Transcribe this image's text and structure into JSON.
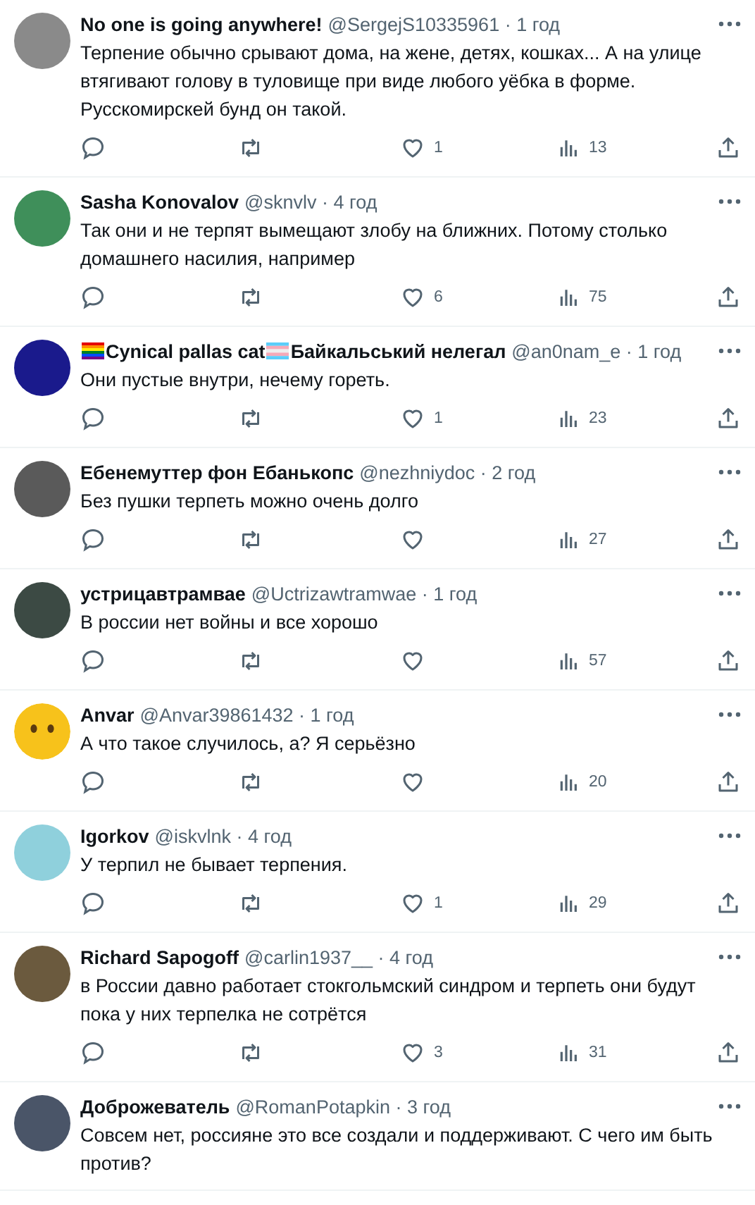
{
  "replies": [
    {
      "avatar": {
        "kind": "photo",
        "color": "#8a8a8a"
      },
      "name_parts": [
        {
          "kind": "text",
          "text": "No one is going anywhere!"
        }
      ],
      "byline": "@SergejS10335961 · 1 год",
      "text": "Терпение обычно срывают дома, на жене, детях, кошках... А на улице втягивают голову в туловище при виде любого уёбка в форме. Русскомирскей бунд он такой.",
      "likes": "1",
      "views": "13"
    },
    {
      "avatar": {
        "kind": "photo",
        "color": "#3f8f5a"
      },
      "name_parts": [
        {
          "kind": "text",
          "text": "Sasha Konovalov"
        }
      ],
      "byline": "@sknvlv · 4 год",
      "text": "Так они и не терпят вымещают злобу на ближних. Потому столько домашнего насилия, например",
      "likes": "6",
      "views": "75"
    },
    {
      "avatar": {
        "kind": "photo",
        "color": "#1a1a8c"
      },
      "name_parts": [
        {
          "kind": "rainbow_flag"
        },
        {
          "kind": "text",
          "text": "Cynical pallas cat"
        },
        {
          "kind": "striped_flag"
        },
        {
          "kind": "text",
          "text": "Байкальський нелегал"
        }
      ],
      "byline": "@an0nam_e · 1 год",
      "text": "Они пустые внутри, нечему гореть.",
      "likes": "1",
      "views": "23"
    },
    {
      "avatar": {
        "kind": "photo",
        "color": "#5a5a5a"
      },
      "name_parts": [
        {
          "kind": "text",
          "text": "Ебенемуттер фон Ебанькопс"
        }
      ],
      "byline": "@nezhniydoc · 2 год",
      "text": "Без пушки терпеть можно очень долго",
      "views": "27"
    },
    {
      "avatar": {
        "kind": "photo",
        "color": "#3c4a44"
      },
      "name_parts": [
        {
          "kind": "text",
          "text": "устрицавтрамвае"
        }
      ],
      "byline": "@Uctrizawtramwae · 1 год",
      "text": "В россии нет войны и все хорошо",
      "views": "57"
    },
    {
      "avatar": {
        "kind": "emoji_face",
        "color": "#f7c21b"
      },
      "name_parts": [
        {
          "kind": "text",
          "text": "Anvar"
        }
      ],
      "byline": "@Anvar39861432 · 1 год",
      "text": "А что такое случилось, а? Я серьёзно",
      "views": "20"
    },
    {
      "avatar": {
        "kind": "photo",
        "color": "#8fd0dc"
      },
      "name_parts": [
        {
          "kind": "text",
          "text": "Igorkov"
        }
      ],
      "byline": "@iskvlnk · 4 год",
      "text": "У терпил не бывает терпения.",
      "likes": "1",
      "views": "29"
    },
    {
      "avatar": {
        "kind": "photo",
        "color": "#6b5a3e"
      },
      "name_parts": [
        {
          "kind": "text",
          "text": "Richard Sapogoff"
        }
      ],
      "byline": "@carlin1937__ · 4 год",
      "text": "в России давно работает стокгольмский синдром и терпеть они будут пока у них терпелка не сотрётся",
      "likes": "3",
      "views": "31"
    },
    {
      "avatar": {
        "kind": "photo",
        "color": "#4a5568"
      },
      "name_parts": [
        {
          "kind": "text",
          "text": "Доброжеватель"
        }
      ],
      "byline": "@RomanPotapkin · 3 год",
      "text": "Совсем нет, россияне это все создали и поддерживают. С чего им быть против?"
    }
  ]
}
